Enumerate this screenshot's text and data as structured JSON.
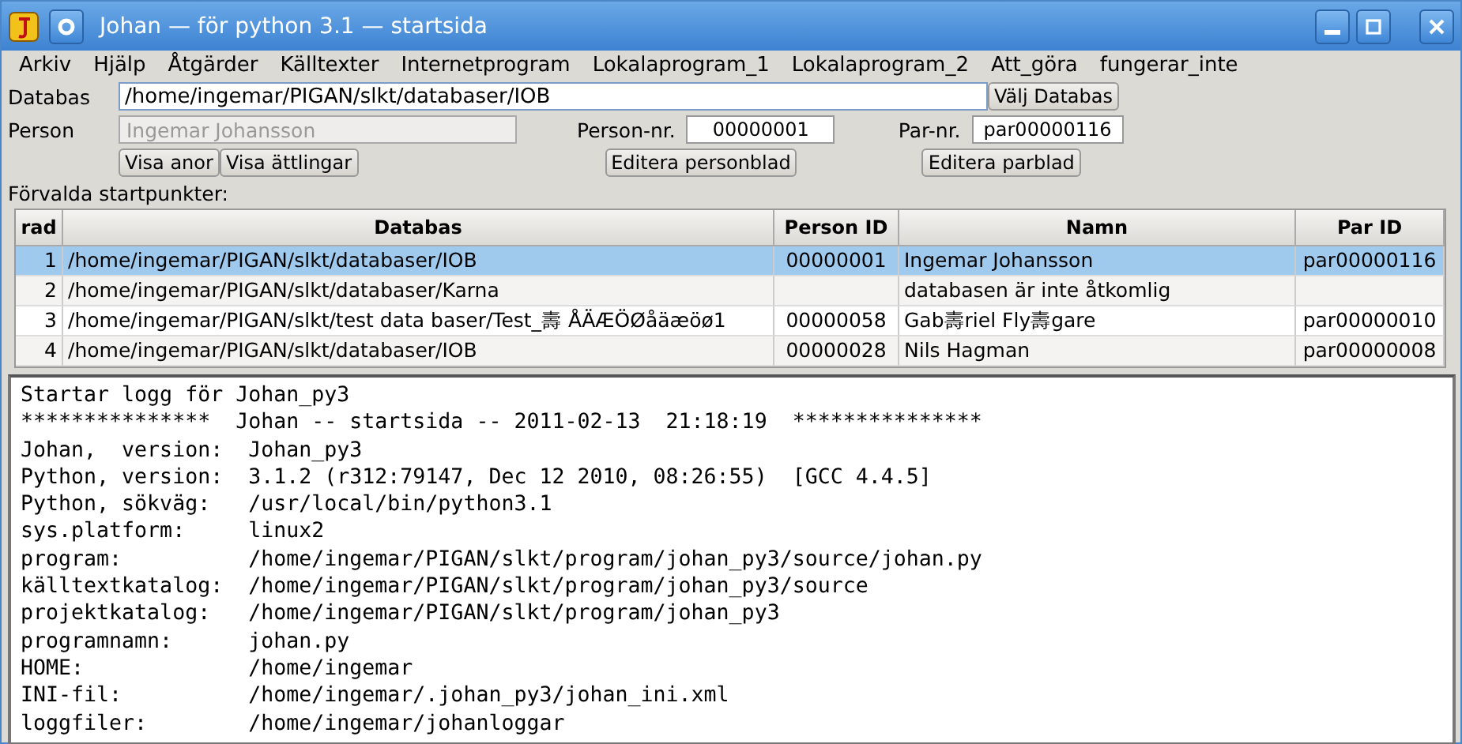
{
  "window": {
    "title": "Johan  — för python 3.1  — startsida"
  },
  "menu": [
    "Arkiv",
    "Hjälp",
    "Åtgärder",
    "Källtexter",
    "Internetprogram",
    "Lokalaprogram_1",
    "Lokalaprogram_2",
    "Att_göra",
    "fungerar_inte"
  ],
  "form": {
    "database_label": "Databas",
    "database_value": "/home/ingemar/PIGAN/slkt/databaser/IOB",
    "choose_button": "Välj Databas",
    "person_label": "Person",
    "person_value": "Ingemar Johansson",
    "person_nr_label": "Person-nr.",
    "person_nr_value": "00000001",
    "par_nr_label": "Par-nr.",
    "par_nr_value": "par00000116",
    "buttons": [
      "Visa anor",
      "Visa ättlingar"
    ],
    "edit_person_button": "Editera personblad",
    "edit_par_button": "Editera parblad"
  },
  "table": {
    "title": "Förvalda startpunkter:",
    "columns": [
      "rad",
      "Databas",
      "Person ID",
      "Namn",
      "Par ID"
    ],
    "rows": [
      {
        "cells": [
          "1",
          "/home/ingemar/PIGAN/slkt/databaser/IOB",
          "00000001",
          "Ingemar Johansson",
          "par00000116"
        ],
        "selected": true
      },
      {
        "cells": [
          "2",
          "/home/ingemar/PIGAN/slkt/databaser/Karna",
          "",
          "databasen är inte åtkomlig",
          ""
        ],
        "selected": false
      },
      {
        "cells": [
          "3",
          "/home/ingemar/PIGAN/slkt/test data baser/Test_壽 ÅÄÆÖØåäæöø1",
          "00000058",
          "Gab壽riel Fly壽gare",
          "par00000010"
        ],
        "selected": false
      },
      {
        "cells": [
          "4",
          "/home/ingemar/PIGAN/slkt/databaser/IOB",
          "00000028",
          "Nils Hagman",
          "par00000008"
        ],
        "selected": false
      }
    ]
  },
  "log": [
    "Startar logg för Johan_py3",
    "***************  Johan -- startsida -- 2011-02-13  21:18:19  ***************",
    "Johan,  version:  Johan_py3",
    "Python, version:  3.1.2 (r312:79147, Dec 12 2010, 08:26:55)  [GCC 4.4.5]",
    "Python, sökväg:   /usr/local/bin/python3.1",
    "sys.platform:     linux2",
    "program:          /home/ingemar/PIGAN/slkt/program/johan_py3/source/johan.py",
    "källtextkatalog:  /home/ingemar/PIGAN/slkt/program/johan_py3/source",
    "projektkatalog:   /home/ingemar/PIGAN/slkt/program/johan_py3",
    "programnamn:      johan.py",
    "HOME:             /home/ingemar",
    "INI-fil:          /home/ingemar/.johan_py3/johan_ini.xml",
    "loggfiler:        /home/ingemar/johanloggar"
  ]
}
